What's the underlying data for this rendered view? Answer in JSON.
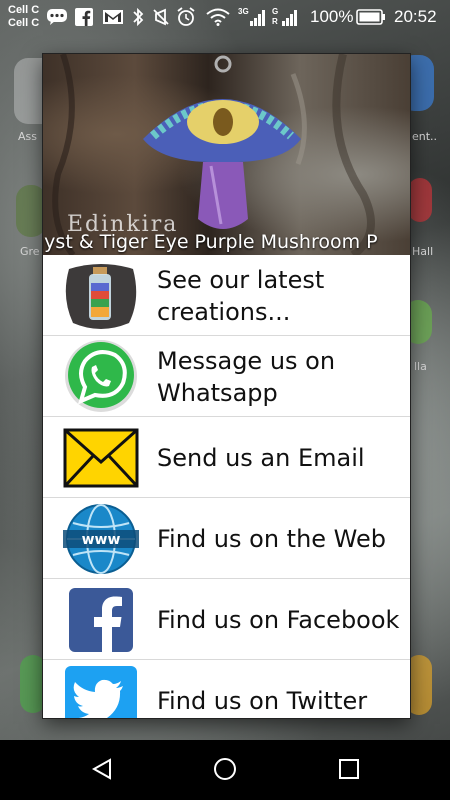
{
  "status_bar": {
    "carrier_1": "Cell C",
    "carrier_2": "Cell C",
    "network_1": "3G",
    "network_2": "G",
    "network_2_sub": "R",
    "battery_percent": "100%",
    "time": "20:52"
  },
  "background": {
    "labels": [
      "Ass",
      "ent..",
      "Gre",
      "Hall",
      "lla"
    ]
  },
  "dialog": {
    "banner": {
      "watermark": "Edinkira",
      "caption": "ethyst & Tiger Eye Purple Mushroom P"
    },
    "items": [
      {
        "label": "See our latest creations...",
        "icon": "bottle-photo-icon"
      },
      {
        "label": "Message us on Whatsapp",
        "icon": "whatsapp-icon"
      },
      {
        "label": "Send us an Email",
        "icon": "envelope-icon"
      },
      {
        "label": "Find us on the Web",
        "icon": "www-globe-icon"
      },
      {
        "label": "Find us on Facebook",
        "icon": "facebook-icon"
      },
      {
        "label": "Find us on Twitter",
        "icon": "twitter-icon"
      }
    ]
  },
  "colors": {
    "whatsapp": "#2fb84a",
    "envelope": "#ffd400",
    "facebook": "#3b5998",
    "twitter": "#1da1f2",
    "web": "#1a88c9"
  }
}
